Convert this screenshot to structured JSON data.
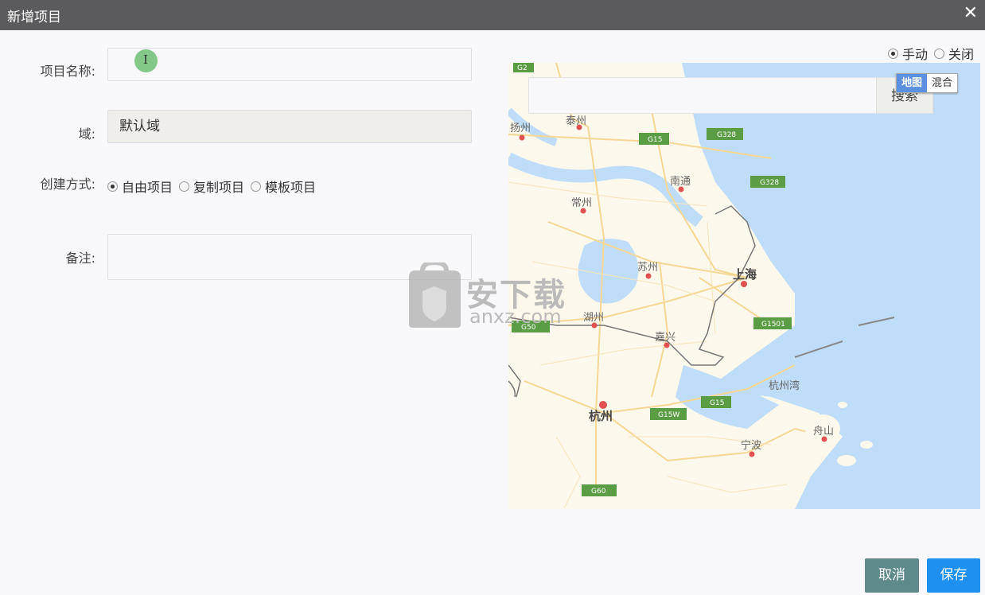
{
  "dialog": {
    "title": "新增项目",
    "close_icon": "close-icon"
  },
  "form": {
    "name_label": "项目名称:",
    "name_value": "",
    "domain_label": "域:",
    "domain_value": "默认域",
    "method_label": "创建方式:",
    "methods": [
      {
        "label": "自由项目",
        "checked": true
      },
      {
        "label": "复制项目",
        "checked": false
      },
      {
        "label": "模板项目",
        "checked": false
      }
    ],
    "remark_label": "备注:",
    "remark_value": ""
  },
  "map_mode": {
    "options": [
      {
        "label": "手动",
        "checked": true
      },
      {
        "label": "关闭",
        "checked": false
      }
    ]
  },
  "map": {
    "search_placeholder": "",
    "search_button": "搜索",
    "type_map": "地图",
    "type_hybrid": "混合",
    "places": [
      "扬州",
      "泰州",
      "南通",
      "常州",
      "苏州",
      "上海",
      "湖州",
      "嘉兴",
      "杭州湾",
      "杭州",
      "宁波",
      "舟山"
    ],
    "roads": [
      "G2",
      "G15",
      "G328",
      "G328",
      "G1501",
      "G15",
      "G15W",
      "G50",
      "G60"
    ]
  },
  "watermark": {
    "text": "安下载",
    "sub": "anxz.com"
  },
  "actions": {
    "cancel": "取消",
    "save": "保存"
  },
  "colors": {
    "titlebar": "#5b5b5d",
    "sea": "#bfddf9",
    "land": "#fdf8ec",
    "save": "#1e90f0",
    "cancel": "#5e8a8a"
  }
}
